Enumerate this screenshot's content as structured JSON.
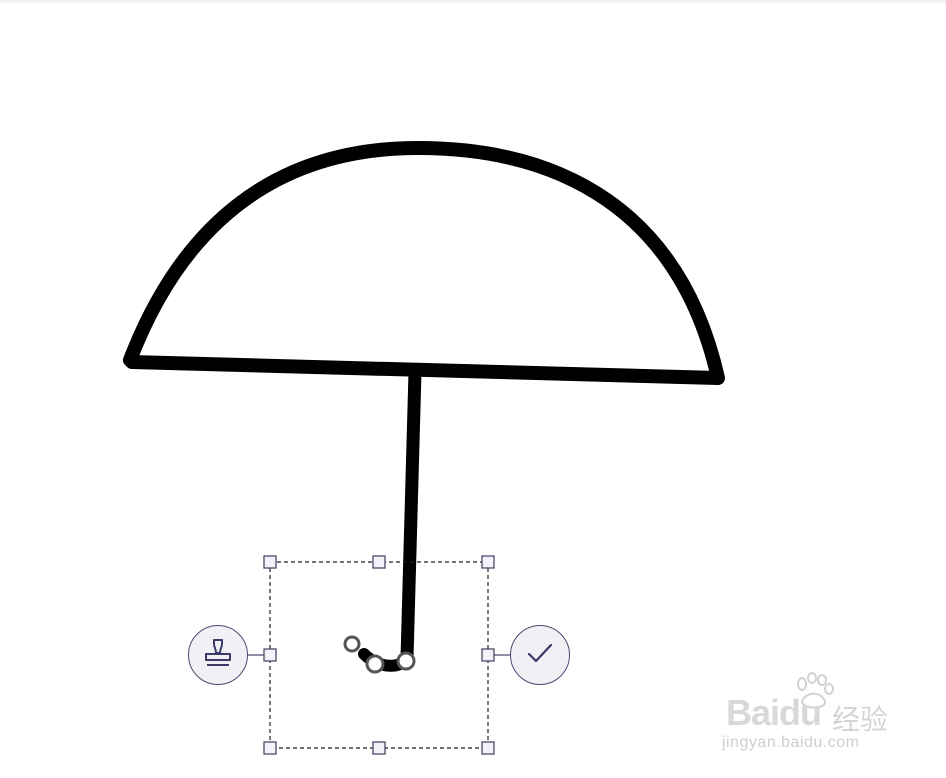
{
  "colors": {
    "stroke": "#000000",
    "selection": "#2b2b3a",
    "handle_fill": "#f2f2f8",
    "handle_stroke": "#4a4a6a",
    "button_fill": "#f0f0f5",
    "button_stroke": "#4b4b73",
    "watermark": "#cccccc"
  },
  "icons": {
    "stamp": "stamp-icon",
    "confirm": "checkmark-icon"
  },
  "watermark": {
    "logo": "Baidu",
    "cn": "经验",
    "url": "jingyan.baidu.com"
  }
}
